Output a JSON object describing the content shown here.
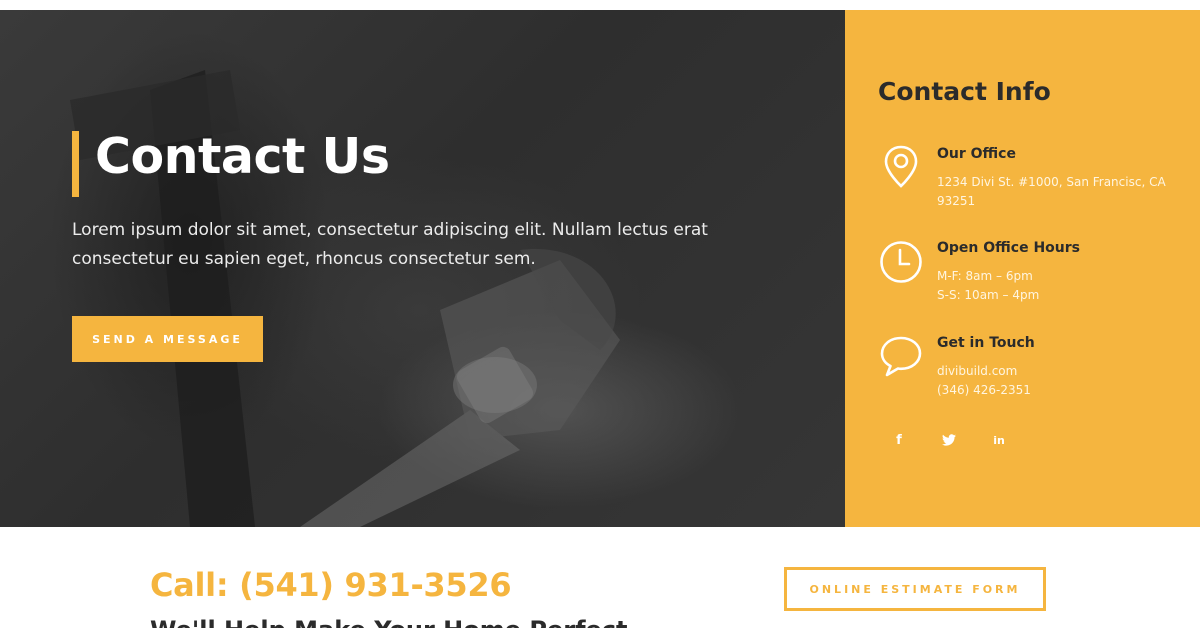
{
  "hero": {
    "title": "Contact Us",
    "text": "Lorem ipsum dolor sit amet, consectetur adipiscing elit. Nullam lectus erat consectetur eu sapien eget, rhoncus consectetur sem.",
    "button_label": "SEND A MESSAGE"
  },
  "contact_info": {
    "title": "Contact Info",
    "items": [
      {
        "icon": "map-pin-icon",
        "heading": "Our Office",
        "lines": [
          "1234 Divi St. #1000, San Francisc, CA",
          "93251"
        ]
      },
      {
        "icon": "clock-icon",
        "heading": "Open Office Hours",
        "lines": [
          "M-F: 8am – 6pm",
          "S-S: 10am – 4pm"
        ]
      },
      {
        "icon": "chat-bubble-icon",
        "heading": "Get in Touch",
        "lines": [
          "divibuild.com",
          "(346) 426-2351"
        ]
      }
    ],
    "social": [
      {
        "icon": "facebook-icon",
        "glyph": "f"
      },
      {
        "icon": "twitter-icon",
        "glyph": "🐦"
      },
      {
        "icon": "linkedin-icon",
        "glyph": "in"
      }
    ]
  },
  "footer": {
    "call": "Call: (541) 931-3526",
    "subline": "We'll Help Make Your Home Perfect",
    "estimate_label": "ONLINE ESTIMATE FORM"
  },
  "colors": {
    "accent": "#f5b53f",
    "dark_text": "#2b2b2b",
    "hero_bg": "#333333"
  }
}
